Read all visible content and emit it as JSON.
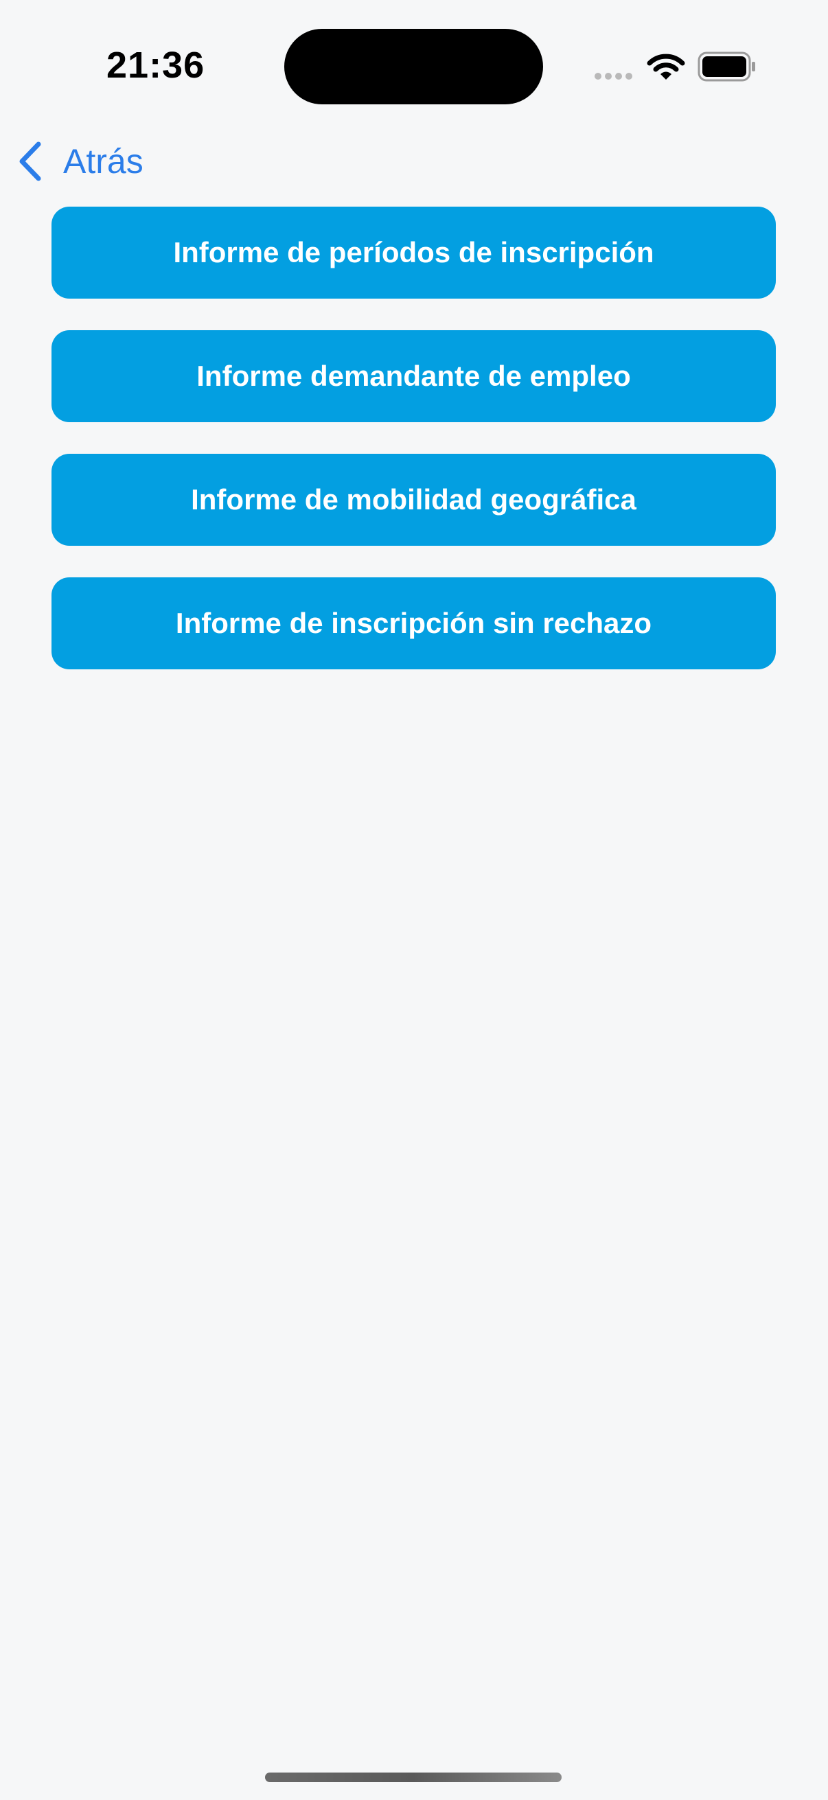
{
  "status_bar": {
    "time": "21:36"
  },
  "nav": {
    "back_label": "Atrás"
  },
  "reports": [
    {
      "label": "Informe de períodos de inscripción"
    },
    {
      "label": "Informe demandante de empleo"
    },
    {
      "label": "Informe de mobilidad geográfica"
    },
    {
      "label": "Informe de inscripción sin rechazo"
    }
  ],
  "colors": {
    "accent": "#039fe1",
    "link": "#2b7de9",
    "background": "#f6f7f8"
  },
  "icons": {
    "back": "chevron-left-icon",
    "signal": "cellular-signal-icon",
    "wifi": "wifi-icon",
    "battery": "battery-icon"
  }
}
